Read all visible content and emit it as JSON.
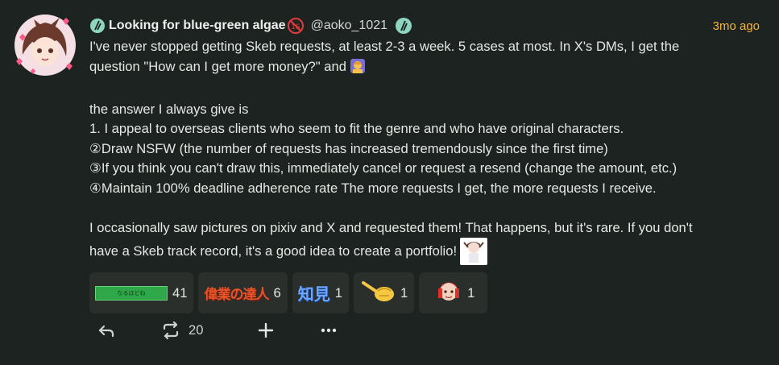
{
  "note": {
    "display_name": "Looking for blue-green algae",
    "username": "@aoko_1021",
    "timestamp": "3mo ago",
    "body": [
      "I've never stopped getting Skeb requests, at least 2-3 a week. 5 cases at most. In X's DMs, I get the",
      "question \"How can I get more money?\" and",
      "",
      "the answer I always give is",
      "1. I appeal to overseas clients who seem to fit the genre and who have original characters.",
      "②Draw NSFW (the number of requests has increased tremendously since the first time)",
      "③If you think you can't draw this, immediately cancel or request a resend (change the amount, etc.)",
      "④Maintain 100% deadline adherence rate The more requests I get, the more requests I receive.",
      "",
      "I occasionally saw pictures on pixiv and X and requested them! That happens, but it's rare. If you don't",
      "have a Skeb track record, it's a good idea to create a portfolio!"
    ]
  },
  "reactions": [
    {
      "icon": "green-banner-emoji",
      "label": "なるほどね",
      "count": "41"
    },
    {
      "icon": "gyougyou-no-tatsujin-emoji",
      "label": "偉業の達人",
      "count": "6"
    },
    {
      "icon": "chiken-emoji",
      "label": "知見",
      "count": "1"
    },
    {
      "icon": "pointing-hand-emoji",
      "count": "1"
    },
    {
      "icon": "character-emoji",
      "count": "1"
    }
  ],
  "actions": {
    "reply_icon": "reply-icon",
    "renote_icon": "renote-icon",
    "renote_count": "20",
    "react_icon": "plus-icon",
    "more_icon": "more-icon"
  },
  "colors": {
    "background": "#1c2320",
    "accent_time": "#f2b33d",
    "reaction_bg": "#2a2f2c"
  }
}
